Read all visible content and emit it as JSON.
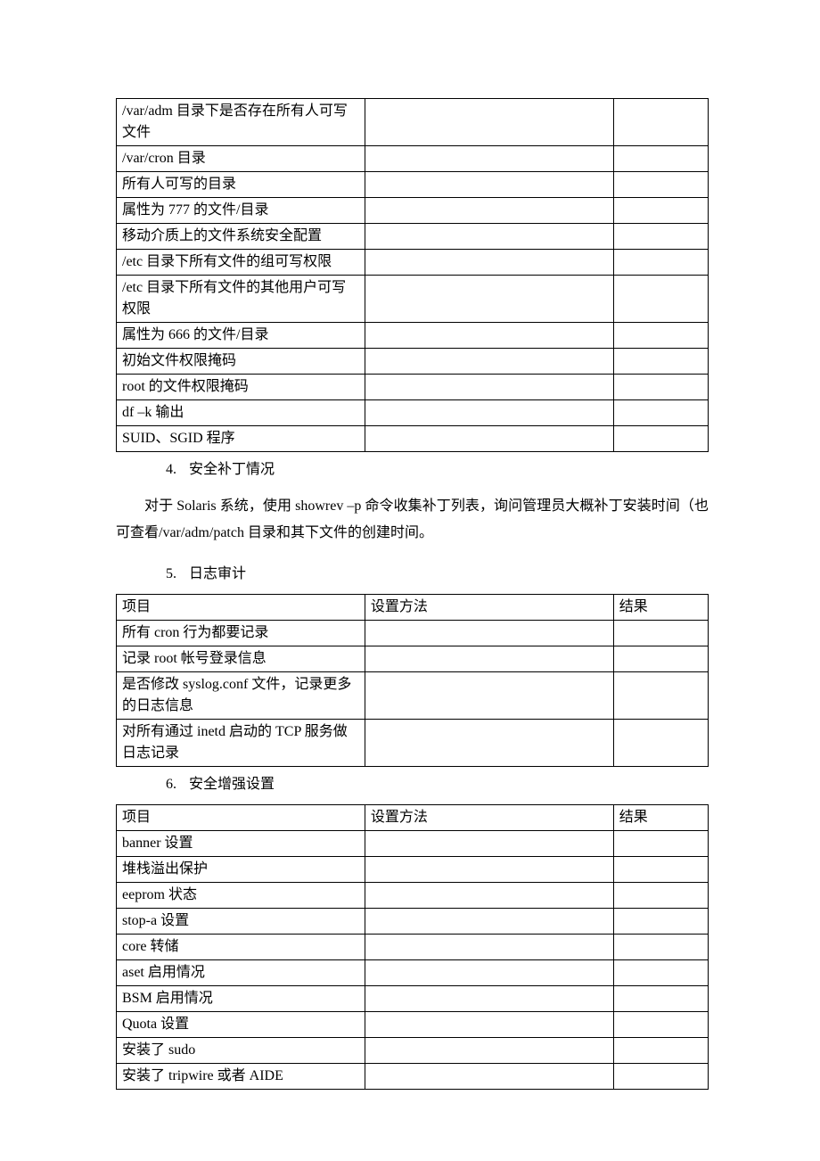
{
  "table1": {
    "rows": [
      "/var/adm 目录下是否存在所有人可写文件",
      "/var/cron 目录",
      "所有人可写的目录",
      "属性为 777 的文件/目录",
      "移动介质上的文件系统安全配置",
      "/etc 目录下所有文件的组可写权限",
      "/etc 目录下所有文件的其他用户可写权限",
      "属性为 666 的文件/目录",
      "初始文件权限掩码",
      "root 的文件权限掩码",
      "df –k 输出",
      "SUID、SGID 程序"
    ]
  },
  "section4": {
    "num": "4.",
    "title": "安全补丁情况",
    "para": "对于 Solaris 系统，使用  showrev –p 命令收集补丁列表，询问管理员大概补丁安装时间（也可查看/var/adm/patch 目录和其下文件的创建时间。"
  },
  "section5": {
    "num": "5.",
    "title": "日志审计",
    "headers": {
      "item": "项目",
      "method": "设置方法",
      "result": "结果"
    },
    "rows": [
      "所有 cron 行为都要记录",
      "记录 root 帐号登录信息",
      "是否修改 syslog.conf 文件，记录更多的日志信息",
      "对所有通过 inetd 启动的 TCP 服务做日志记录"
    ]
  },
  "section6": {
    "num": "6.",
    "title": "安全增强设置",
    "headers": {
      "item": "项目",
      "method": "设置方法",
      "result": "结果"
    },
    "rows": [
      "banner 设置",
      "堆栈溢出保护",
      "eeprom 状态",
      "stop-a 设置",
      "core 转储",
      "aset 启用情况",
      "BSM 启用情况",
      "Quota 设置",
      "安装了 sudo",
      "安装了 tripwire 或者 AIDE"
    ]
  }
}
